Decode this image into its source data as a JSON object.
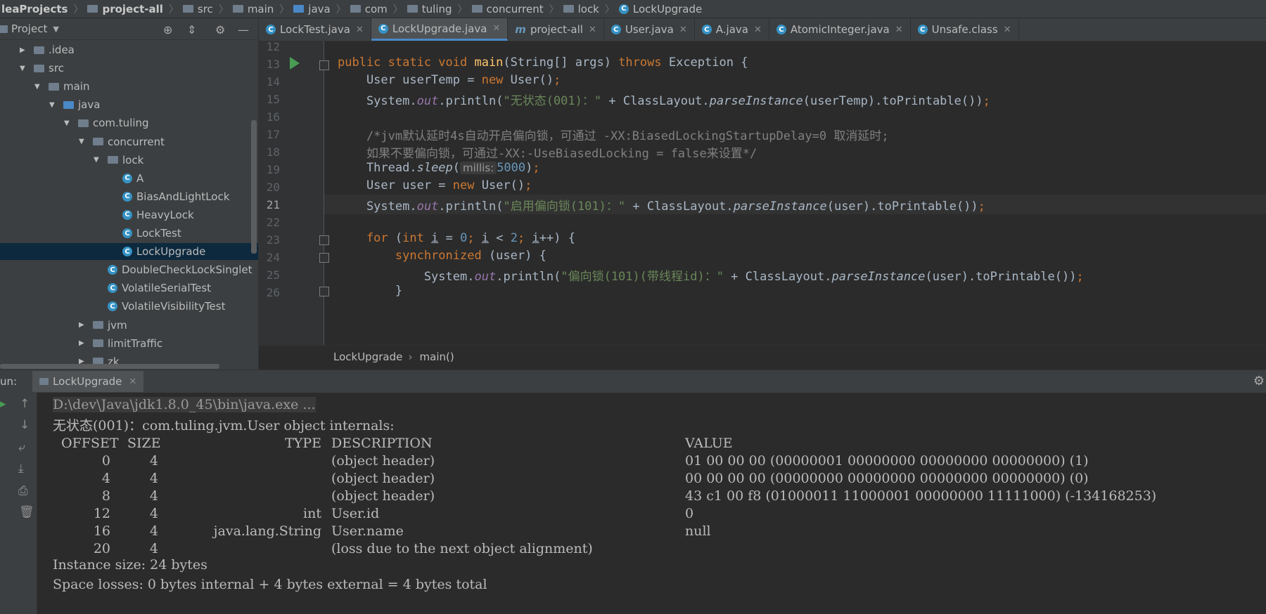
{
  "breadcrumb": [
    "leaProjects",
    "project-all",
    "src",
    "main",
    "java",
    "com",
    "tuling",
    "concurrent",
    "lock",
    "LockUpgrade"
  ],
  "project_panel": {
    "title": "Project",
    "tree": [
      {
        "label": ".idea",
        "kind": "folder",
        "level": 0,
        "arrow": "right"
      },
      {
        "label": "src",
        "kind": "folder",
        "level": 0,
        "arrow": "down"
      },
      {
        "label": "main",
        "kind": "folder",
        "level": 1,
        "arrow": "down"
      },
      {
        "label": "java",
        "kind": "folder-blue",
        "level": 2,
        "arrow": "down"
      },
      {
        "label": "com.tuling",
        "kind": "package",
        "level": 3,
        "arrow": "down"
      },
      {
        "label": "concurrent",
        "kind": "package",
        "level": 4,
        "arrow": "down"
      },
      {
        "label": "lock",
        "kind": "package",
        "level": 5,
        "arrow": "down"
      },
      {
        "label": "A",
        "kind": "class",
        "level": 6,
        "arrow": ""
      },
      {
        "label": "BiasAndLightLock",
        "kind": "class",
        "level": 6,
        "arrow": ""
      },
      {
        "label": "HeavyLock",
        "kind": "class",
        "level": 6,
        "arrow": ""
      },
      {
        "label": "LockTest",
        "kind": "class",
        "level": 6,
        "arrow": ""
      },
      {
        "label": "LockUpgrade",
        "kind": "class",
        "level": 6,
        "arrow": "",
        "selected": true
      },
      {
        "label": "DoubleCheckLockSinglet",
        "kind": "class",
        "level": 5,
        "arrow": ""
      },
      {
        "label": "VolatileSerialTest",
        "kind": "class",
        "level": 5,
        "arrow": ""
      },
      {
        "label": "VolatileVisibilityTest",
        "kind": "class",
        "level": 5,
        "arrow": ""
      },
      {
        "label": "jvm",
        "kind": "package",
        "level": 4,
        "arrow": "right"
      },
      {
        "label": "limitTraffic",
        "kind": "package",
        "level": 4,
        "arrow": "right"
      },
      {
        "label": "zk",
        "kind": "package",
        "level": 4,
        "arrow": "right"
      }
    ]
  },
  "tabs": [
    {
      "label": "LockTest.java",
      "icon": "C"
    },
    {
      "label": "LockUpgrade.java",
      "icon": "C",
      "active": true
    },
    {
      "label": "project-all",
      "icon": "m"
    },
    {
      "label": "User.java",
      "icon": "C"
    },
    {
      "label": "A.java",
      "icon": "C"
    },
    {
      "label": "AtomicInteger.java",
      "icon": "C"
    },
    {
      "label": "Unsafe.class",
      "icon": "C"
    }
  ],
  "editor": {
    "line_numbers": [
      "12",
      "13",
      "14",
      "15",
      "16",
      "17",
      "18",
      "19",
      "20",
      "21",
      "22",
      "23",
      "24",
      "25",
      "26"
    ],
    "current_line": "21",
    "hint_label": "millis:",
    "code": {
      "l13_a": "public static void ",
      "l13_b": "main",
      "l13_c": "(String[] args) ",
      "l13_d": "throws ",
      "l13_e": "Exception {",
      "l14_a": "    User userTemp = ",
      "l14_b": "new ",
      "l14_c": "User()",
      "l14_d": ";",
      "l15_a": "    System.",
      "l15_b": "out",
      "l15_c": ".",
      "l15_d": "println",
      "l15_e": "(",
      "l15_f": "\"无状态(001)：\"",
      "l15_g": " + ClassLayout.",
      "l15_h": "parseInstance",
      "l15_i": "(userTemp).toPrintable())",
      "l15_j": ";",
      "l17": "    /*jvm默认延时4s自动开启偏向锁，可通过 -XX:BiasedLockingStartupDelay=0 取消延时;",
      "l18": "    如果不要偏向锁，可通过-XX:-UseBiasedLocking = false来设置*/",
      "l19_a": "    Thread.",
      "l19_b": "sleep",
      "l19_c": "(",
      "l19_d": "5000",
      "l19_e": ")",
      "l19_f": ";",
      "l20_a": "    User user = ",
      "l20_b": "new ",
      "l20_c": "User()",
      "l20_d": ";",
      "l21_a": "    System.",
      "l21_b": "out",
      "l21_c": ".",
      "l21_d": "println",
      "l21_e": "(",
      "l21_f": "\"启用偏向锁(101)：\"",
      "l21_g": " + ClassLayout.",
      "l21_h": "parseInstance",
      "l21_i": "(user).toPrintable())",
      "l21_j": ";",
      "l23_a": "    for ",
      "l23_b": "(",
      "l23_c": "int ",
      "l23_d": "i",
      "l23_e": " = ",
      "l23_f": "0",
      "l23_g": "; ",
      "l23_h": "i",
      "l23_i": " < ",
      "l23_j": "2",
      "l23_k": "; ",
      "l23_l": "i",
      "l23_m": "++) {",
      "l24_a": "        synchronized ",
      "l24_b": "(user) {",
      "l25_a": "            System.",
      "l25_b": "out",
      "l25_c": ".",
      "l25_d": "println",
      "l25_e": "(",
      "l25_f": "\"偏向锁(101)(带线程id)：\"",
      "l25_g": " + ClassLayout.",
      "l25_h": "parseInstance",
      "l25_i": "(user).toPrintable())",
      "l25_j": ";",
      "l26": "        }"
    }
  },
  "editor_breadcrumb": [
    "LockUpgrade",
    "main()"
  ],
  "run_panel": {
    "label": "un:",
    "tab": "LockUpgrade",
    "console": {
      "cmd": "D:\\dev\\Java\\jdk1.8.0_45\\bin\\java.exe ...",
      "line1": "无状态(001)：com.tuling.jvm.User object internals:",
      "headers": {
        "offset": "OFFSET",
        "size": "SIZE",
        "type": "TYPE",
        "description": "DESCRIPTION",
        "value": "VALUE"
      },
      "rows": [
        {
          "offset": "0",
          "size": "4",
          "type": "",
          "description": "(object header)",
          "value": "01 00 00 00 (00000001 00000000 00000000 00000000) (1)"
        },
        {
          "offset": "4",
          "size": "4",
          "type": "",
          "description": "(object header)",
          "value": "00 00 00 00 (00000000 00000000 00000000 00000000) (0)"
        },
        {
          "offset": "8",
          "size": "4",
          "type": "",
          "description": "(object header)",
          "value": "43 c1 00 f8 (01000011 11000001 00000000 11111000) (-134168253)"
        },
        {
          "offset": "12",
          "size": "4",
          "type": "int",
          "description": "User.id",
          "value": "0"
        },
        {
          "offset": "16",
          "size": "4",
          "type": "java.lang.String",
          "description": "User.name",
          "value": "null"
        },
        {
          "offset": "20",
          "size": "4",
          "type": "",
          "description": "(loss due to the next object alignment)",
          "value": ""
        }
      ],
      "instance_size": "Instance size: 24 bytes",
      "space_losses": "Space losses: 0 bytes internal + 4 bytes external = 4 bytes total"
    }
  }
}
